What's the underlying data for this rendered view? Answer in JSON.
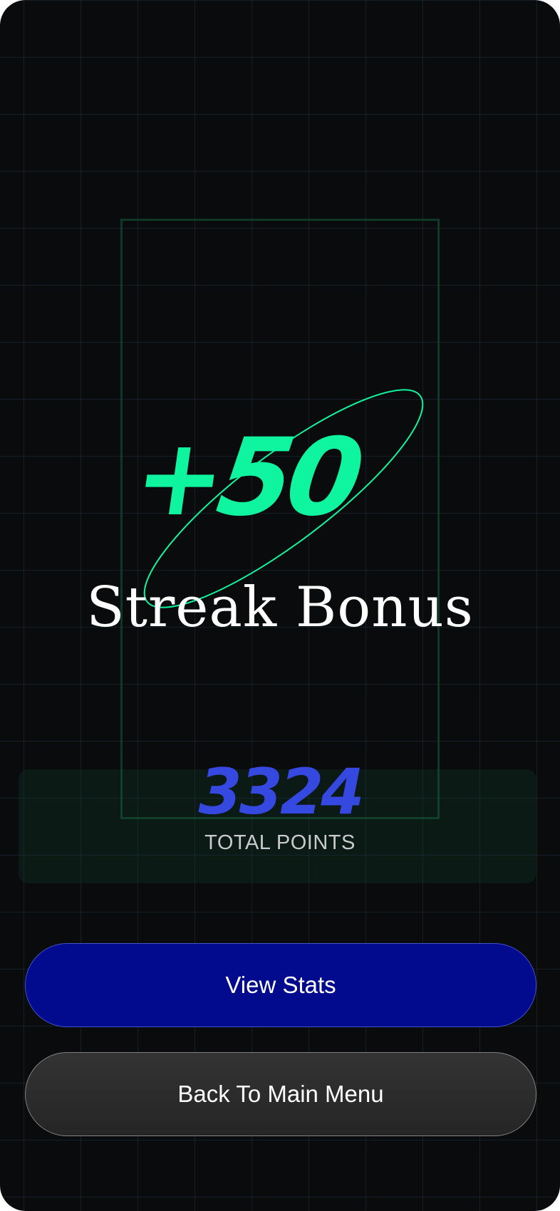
{
  "bonus": {
    "amount": "+50",
    "title": "Streak Bonus"
  },
  "points": {
    "value": "3324",
    "label": "TOTAL POINTS"
  },
  "buttons": {
    "view_stats": "View Stats",
    "back_to_menu": "Back To Main Menu"
  },
  "colors": {
    "background": "#0a0b0c",
    "bonus_green": "#0ff59f",
    "points_blue": "#3548e0",
    "primary_button": "#020a8e",
    "secondary_button": "#2b2b2b",
    "text_white": "#ffffff"
  }
}
